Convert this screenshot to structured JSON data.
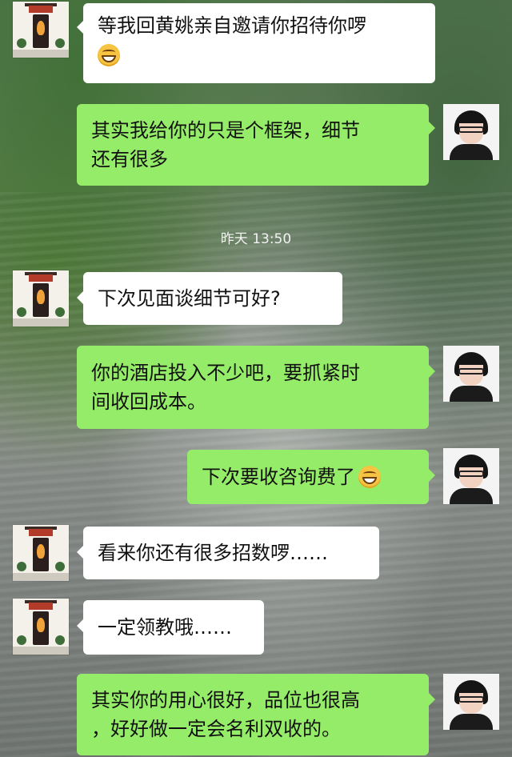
{
  "chat": {
    "timestamp": "昨天 13:50",
    "messages": [
      {
        "side": "in",
        "text": "等我回黄姚亲自邀请你招待你啰",
        "emoji": "grinning-face-emoji"
      },
      {
        "side": "out",
        "text": "其实我给你的只是个框架，细节\n还有很多"
      },
      {
        "side": "in",
        "text": "下次见面谈细节可好?"
      },
      {
        "side": "out",
        "text": "你的酒店投入不少吧，要抓紧时\n间收回成本。"
      },
      {
        "side": "out",
        "text": "下次要收咨询费了",
        "emoji": "grinning-face-emoji"
      },
      {
        "side": "in",
        "text": "看来你还有很多招数啰……"
      },
      {
        "side": "in",
        "text": "一定领教哦……"
      },
      {
        "side": "out",
        "text": "其实你的用心很好，品位也很高\n，好好做一定会名利双收的。"
      }
    ]
  },
  "avatars": {
    "left": "storefront-avatar",
    "right": "person-with-glasses-avatar"
  },
  "colors": {
    "incoming_bubble": "#ffffff",
    "outgoing_bubble": "#95ec69"
  }
}
